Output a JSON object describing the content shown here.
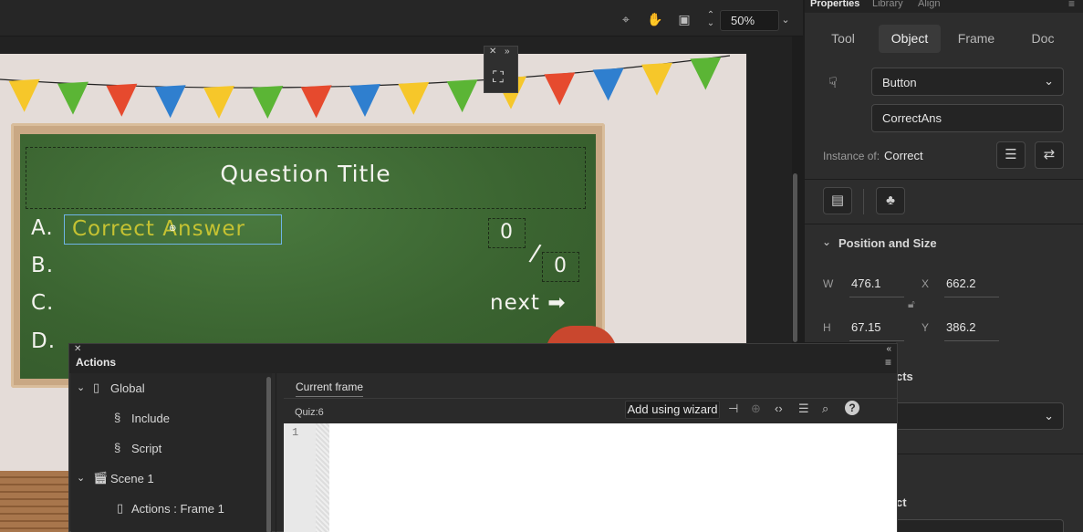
{
  "toolbar": {
    "zoom_value": "50%",
    "icons": [
      "crosshair-icon",
      "hand-icon",
      "clip-icon",
      "stepper-icon",
      "chevron-down-icon"
    ]
  },
  "stage": {
    "question_title": "Question Title",
    "letters": [
      "A.",
      "B.",
      "C.",
      "D."
    ],
    "answer_text": "Correct Answer",
    "score_left": "0",
    "score_right": "0",
    "slash": "/",
    "next_label": "next ➡",
    "bunting_colors": [
      "#f6c72a",
      "#5bb535",
      "#e64a2e",
      "#2f7fcf",
      "#f6c72a",
      "#5bb535",
      "#e64a2e",
      "#2f7fcf",
      "#f6c72a",
      "#5bb535",
      "#f6c72a",
      "#e64a2e",
      "#2f7fcf",
      "#f6c72a",
      "#5bb535"
    ]
  },
  "properties": {
    "top_tabs": [
      "Properties",
      "Library",
      "Align"
    ],
    "segments": [
      "Tool",
      "Object",
      "Frame",
      "Doc"
    ],
    "active_segment": "Object",
    "symbol_type": "Button",
    "instance_name": "CorrectAns",
    "instance_of_label": "Instance of:",
    "instance_of_value": "Correct",
    "section_position": "Position and Size",
    "w_label": "W",
    "w_value": "476.1",
    "h_label": "H",
    "h_value": "67.15",
    "x_label": "X",
    "x_value": "662.2",
    "y_label": "Y",
    "y_value": "386.2",
    "partial_section1": "cts",
    "partial_section2": "ct"
  },
  "actions": {
    "title": "Actions",
    "tree": [
      {
        "label": "Global",
        "type": "folder"
      },
      {
        "label": "Include",
        "type": "script"
      },
      {
        "label": "Script",
        "type": "script"
      },
      {
        "label": "Scene 1",
        "type": "scene"
      },
      {
        "label": "Actions : Frame 1",
        "type": "frame"
      }
    ],
    "current_frame_tab": "Current frame",
    "location": "Quiz:6",
    "wizard_label": "Add using wizard",
    "line_number": "1"
  }
}
